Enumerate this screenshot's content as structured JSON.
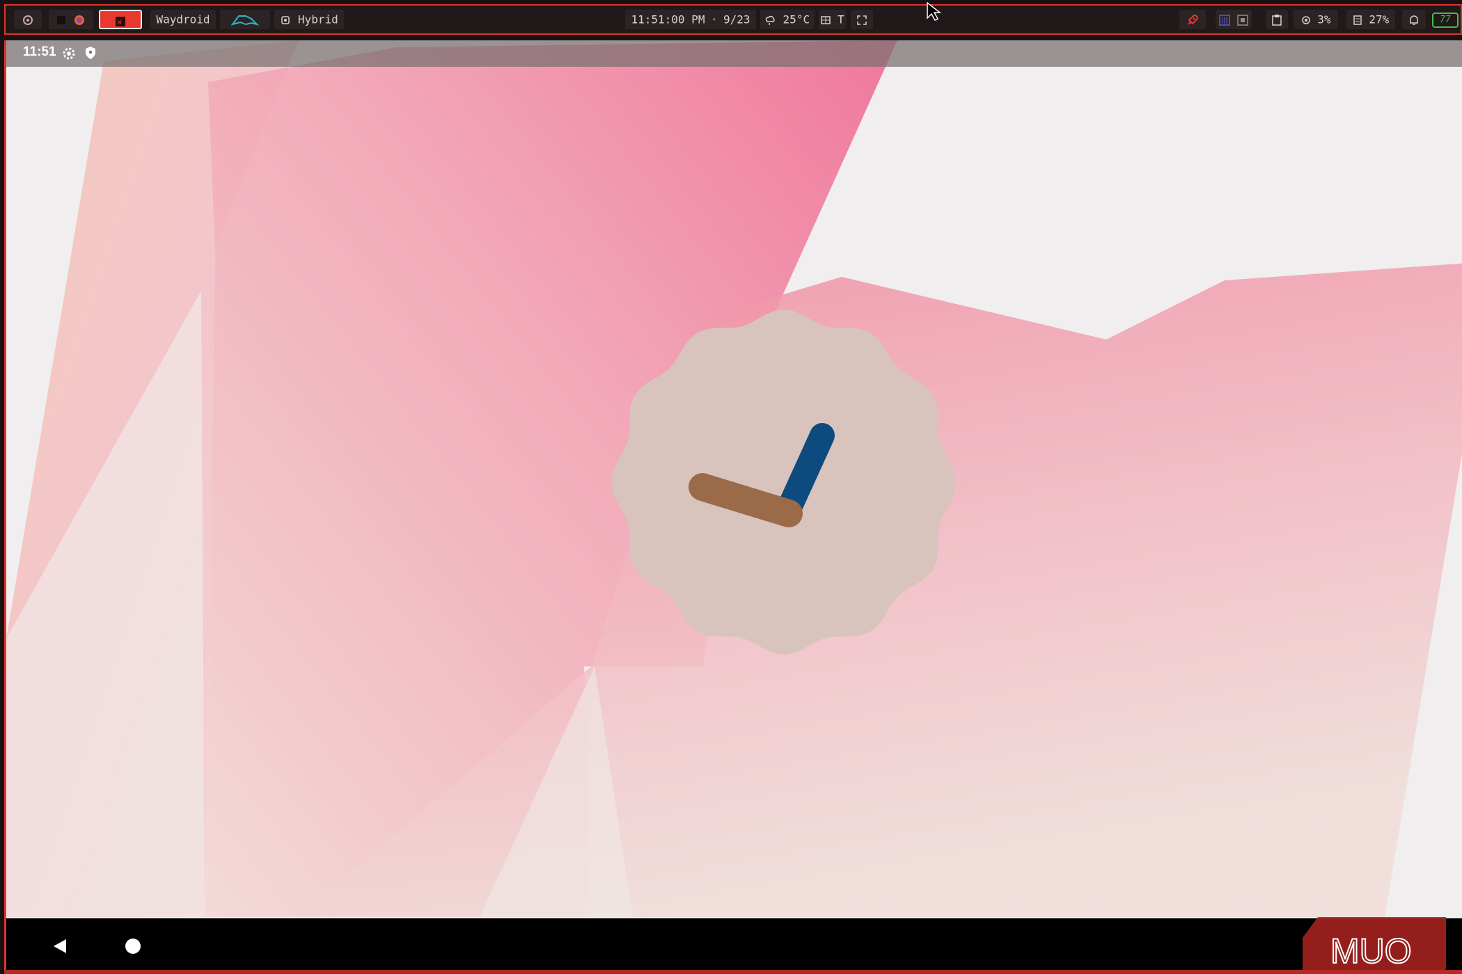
{
  "topbar": {
    "workspace_label": "Waydroid",
    "power_mode_label": "Hybrid",
    "clock_time": "11:51:00 PM",
    "date_separator": "•",
    "date": "9/23",
    "weather_temp": "25°C",
    "keyboard_layout": "T",
    "cpu_usage": "3%",
    "memory_usage": "27%",
    "battery_level": "77"
  },
  "android": {
    "status_time": "11:51"
  },
  "watermark": {
    "text": "MUO"
  },
  "colors": {
    "accent": "#d8362e",
    "clock_face": "#d8c4bc",
    "hour_hand": "#9b6a48",
    "minute_hand": "#0d4a7e",
    "battery": "#3fbf4a"
  },
  "icons": {
    "pinned_app": "app-icon",
    "browser": "firefox-icon",
    "active_app": "terminal-icon",
    "power_mode": "cpu-icon",
    "weather": "cloud-rain-icon",
    "keyboard": "keyboard-icon",
    "screenshot": "fullscreen-icon",
    "launcher": "rocket-icon",
    "clipboard": "clipboard-icon",
    "notifications": "bell-icon",
    "settings": "gear-icon",
    "vpn": "shield-icon",
    "back": "back-icon",
    "home": "home-icon"
  }
}
